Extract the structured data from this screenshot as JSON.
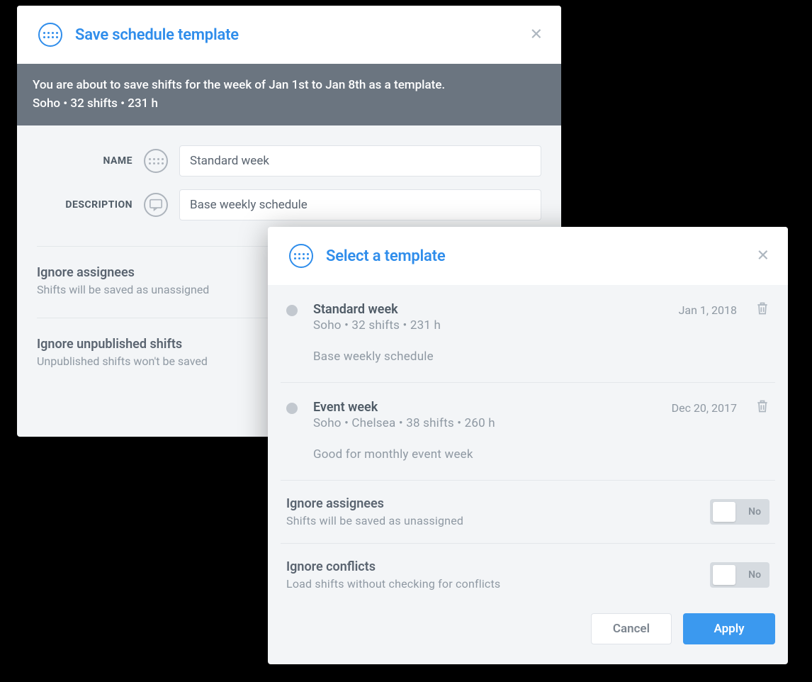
{
  "save_modal": {
    "title": "Save schedule template",
    "banner_line1": "You are about to save shifts for the week of Jan 1st to Jan 8th as a template.",
    "banner_line2": "Soho • 32 shifts • 231 h",
    "name_label": "NAME",
    "name_value": "Standard week",
    "description_label": "DESCRIPTION",
    "description_value": "Base weekly schedule",
    "opt1_title": "Ignore assignees",
    "opt1_desc": "Shifts will be saved as unassigned",
    "opt2_title": "Ignore unpublished shifts",
    "opt2_desc": "Unpublished shifts won't be saved"
  },
  "select_modal": {
    "title": "Select a template",
    "templates": [
      {
        "name": "Standard week",
        "meta": "Soho • 32 shifts • 231 h",
        "desc": "Base weekly schedule",
        "date": "Jan 1, 2018"
      },
      {
        "name": "Event week",
        "meta": "Soho • Chelsea • 38 shifts • 260 h",
        "desc": "Good for monthly event week",
        "date": "Dec 20, 2017"
      }
    ],
    "opt1_title": "Ignore assignees",
    "opt1_desc": "Shifts will be saved as unassigned",
    "opt1_toggle": "No",
    "opt2_title": "Ignore conflicts",
    "opt2_desc": "Load shifts without checking for conflicts",
    "opt2_toggle": "No",
    "cancel": "Cancel",
    "apply": "Apply"
  }
}
